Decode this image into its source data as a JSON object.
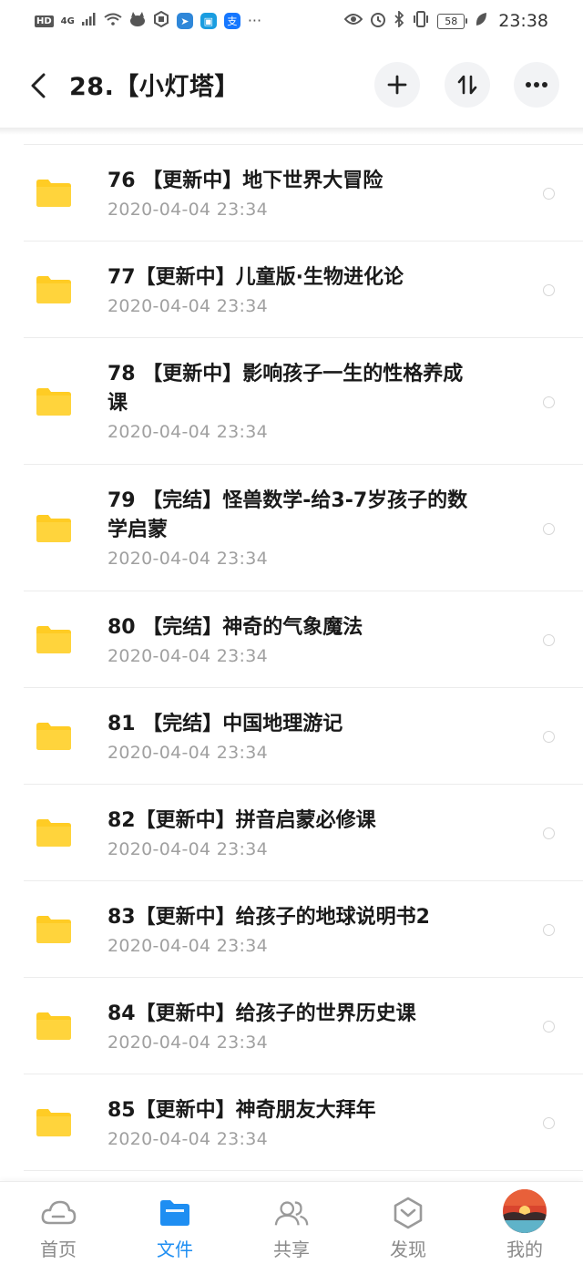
{
  "status_bar": {
    "hd": "HD",
    "network": "4G",
    "battery": "58",
    "time": "23:38",
    "more_indicator": "···"
  },
  "header": {
    "title": "28.【小灯塔】",
    "back_icon": "chevron-left-icon",
    "add_icon": "plus-icon",
    "sort_icon": "sort-icon",
    "more_icon": "more-icon"
  },
  "files": [
    {
      "name_lines": [
        "76 【更新中】地下世界大冒险"
      ],
      "date": "2020-04-04  23:34"
    },
    {
      "name_lines": [
        "77【更新中】儿童版·生物进化论"
      ],
      "date": "2020-04-04  23:34"
    },
    {
      "name_lines": [
        "78 【更新中】影响孩子一生的性格养成",
        "课"
      ],
      "date": "2020-04-04  23:34"
    },
    {
      "name_lines": [
        "79 【完结】怪兽数学-给3-7岁孩子的数",
        "学启蒙"
      ],
      "date": "2020-04-04  23:34"
    },
    {
      "name_lines": [
        "80 【完结】神奇的气象魔法"
      ],
      "date": "2020-04-04  23:34"
    },
    {
      "name_lines": [
        "81 【完结】中国地理游记"
      ],
      "date": "2020-04-04  23:34"
    },
    {
      "name_lines": [
        "82【更新中】拼音启蒙必修课"
      ],
      "date": "2020-04-04  23:34"
    },
    {
      "name_lines": [
        "83【更新中】给孩子的地球说明书2"
      ],
      "date": "2020-04-04  23:34"
    },
    {
      "name_lines": [
        "84【更新中】给孩子的世界历史课"
      ],
      "date": "2020-04-04  23:34"
    },
    {
      "name_lines": [
        "85【更新中】神奇朋友大拜年"
      ],
      "date": "2020-04-04  23:34"
    }
  ],
  "nav": [
    {
      "label": "首页",
      "icon": "cloud-icon",
      "active": false
    },
    {
      "label": "文件",
      "icon": "folder-icon",
      "active": true
    },
    {
      "label": "共享",
      "icon": "people-icon",
      "active": false
    },
    {
      "label": "发现",
      "icon": "compass-icon",
      "active": false
    },
    {
      "label": "我的",
      "icon": "avatar-icon",
      "active": false
    }
  ],
  "colors": {
    "accent": "#1e8ef2",
    "folder": "#ffcc24",
    "date_text": "#a0a0a0",
    "nav_inactive": "#8a8a8a"
  }
}
